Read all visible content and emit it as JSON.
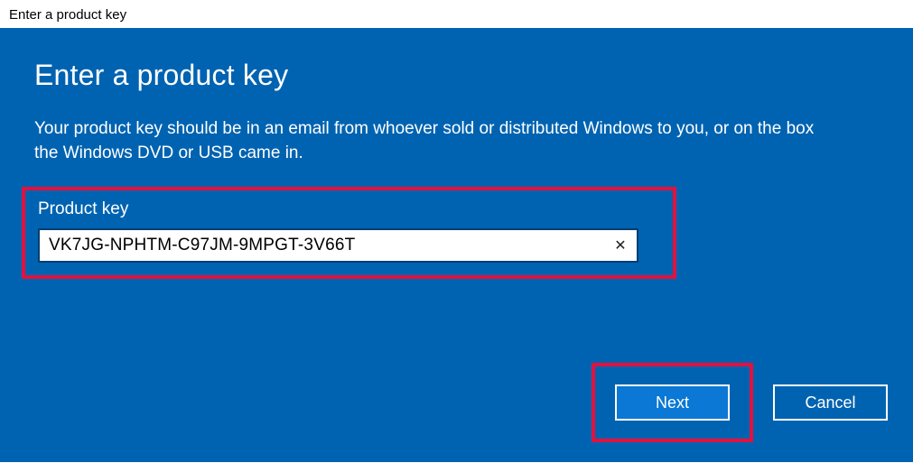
{
  "window": {
    "title": "Enter a product key"
  },
  "dialog": {
    "heading": "Enter a product key",
    "description": "Your product key should be in an email from whoever sold or distributed Windows to you, or on the box the Windows DVD or USB came in.",
    "input_label": "Product key",
    "product_key_value": "VK7JG-NPHTM-C97JM-9MPGT-3V66T",
    "next_label": "Next",
    "cancel_label": "Cancel",
    "clear_icon_glyph": "✕"
  },
  "colors": {
    "panel_bg": "#0063b1",
    "highlight_border": "#e3113d",
    "next_bg": "#0a78d4"
  }
}
